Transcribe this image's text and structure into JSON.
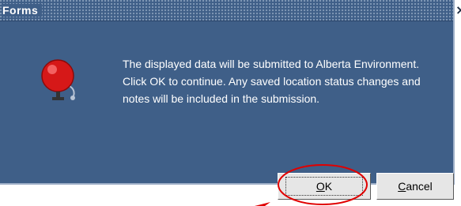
{
  "window": {
    "title": "Forms",
    "close_glyph": "×"
  },
  "dialog": {
    "icon": "alarm-bell-icon",
    "message": "The displayed data will be submitted to Alberta Environment. Click OK to continue. Any saved location status changes and notes will be included in the submission."
  },
  "buttons": {
    "ok": {
      "mnemonic": "O",
      "rest": "K"
    },
    "cancel": {
      "mnemonic": "C",
      "rest": "ancel"
    }
  },
  "colors": {
    "dialog_bg": "#3f5f88",
    "annotation": "#e00000",
    "bell": "#d61818"
  }
}
